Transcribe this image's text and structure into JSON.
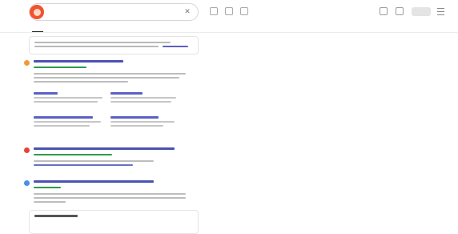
{
  "header": {
    "search_value": "",
    "search_placeholder": "",
    "signin_label": ""
  },
  "tabs": [
    {
      "label": "",
      "active": true
    },
    {
      "label": "",
      "active": false
    },
    {
      "label": "",
      "active": false
    },
    {
      "label": "",
      "active": false
    },
    {
      "label": "",
      "active": false
    },
    {
      "label": "",
      "active": false
    },
    {
      "label": "",
      "active": false
    },
    {
      "label": "",
      "active": false
    },
    {
      "label": "",
      "active": false
    },
    {
      "label": "",
      "active": false
    }
  ],
  "notice": {
    "text": ""
  },
  "results": [
    {
      "favicon_color": "#f29a38",
      "title": "",
      "url": "",
      "snippet": "",
      "sitelinks": [
        {
          "title": "",
          "desc": ""
        },
        {
          "title": "",
          "desc": ""
        },
        {
          "title": "",
          "desc": ""
        },
        {
          "title": "",
          "desc": ""
        }
      ]
    },
    {
      "favicon_color": "#e8403c",
      "title": "",
      "url": "",
      "snippet": ""
    },
    {
      "favicon_color": "#4a8ee8",
      "title": "",
      "url": "",
      "snippet": ""
    }
  ],
  "bottom_card": {
    "heading": ""
  },
  "colors": {
    "logo": "#f0532d",
    "link_title": "#4a52b4",
    "url_green": "#2d9b4a"
  },
  "icons": {
    "logo": "search-engine-logo-icon",
    "clear": "close-icon",
    "toolbar": [
      "keyboard-icon",
      "camera-icon",
      "settings-icon"
    ],
    "right": [
      "apps-icon",
      "notifications-icon"
    ],
    "menu": "hamburger-menu-icon"
  }
}
